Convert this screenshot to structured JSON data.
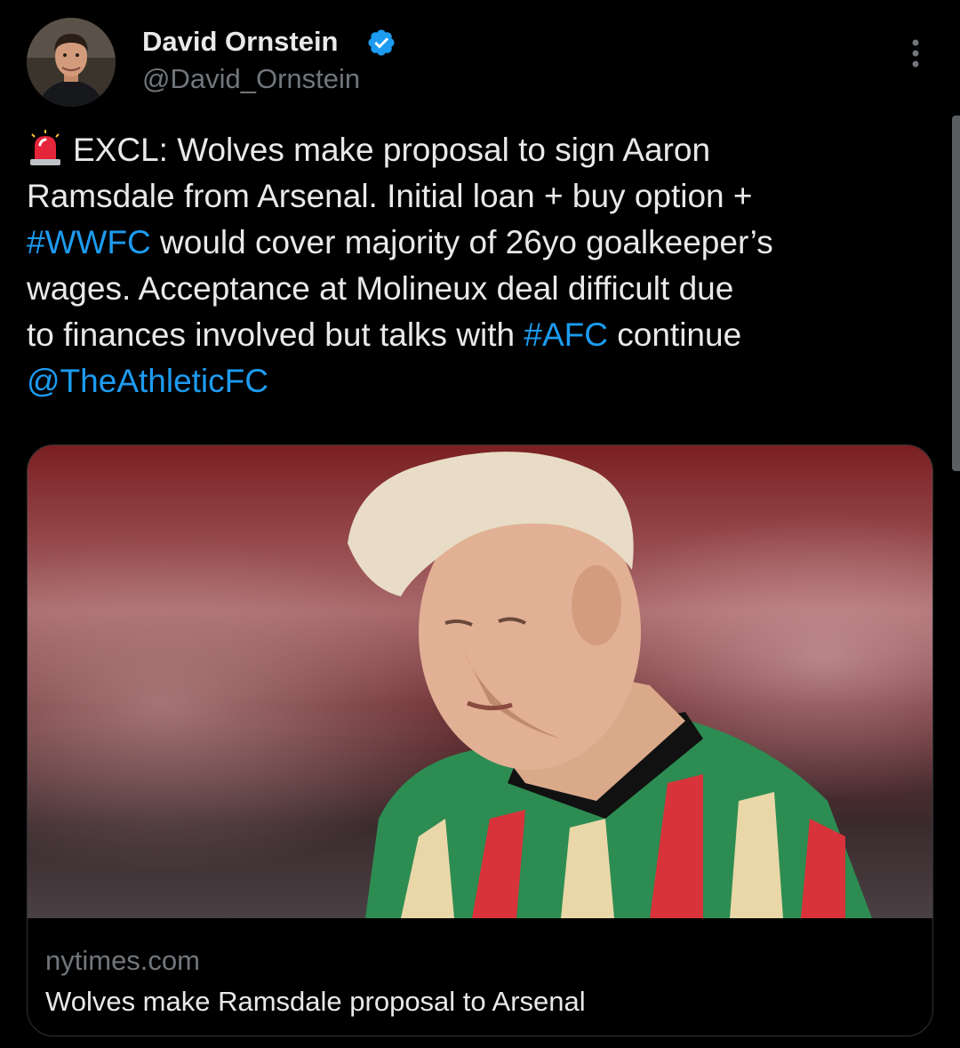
{
  "author": {
    "name": "David Ornstein",
    "handle": "@David_Ornstein",
    "verified_icon": "verified-badge-icon",
    "avatar_icon": "profile-avatar"
  },
  "menu": {
    "icon": "more-vertical-icon"
  },
  "tweet": {
    "emoji_icon": "police-siren-icon",
    "lines": [
      [
        "",
        "EXCL: Wolves make proposal to sign Aaron"
      ],
      [
        "Ramsdale from Arsenal. Initial loan + buy option +"
      ],
      [
        "#WWFC",
        " would cover majority of 26yo goalkeeper’s"
      ],
      [
        "wages. Acceptance at Molineux deal difficult due"
      ],
      [
        "to finances involved but talks with ",
        "#AFC",
        " continue"
      ],
      [
        "@TheAthleticFC"
      ]
    ]
  },
  "card": {
    "image_icon": "article-photo",
    "domain": "nytimes.com",
    "title": "Wolves make Ramsdale proposal to Arsenal"
  },
  "colors": {
    "background": "#000000",
    "text": "#e7e9ea",
    "secondary_text": "#71767b",
    "link": "#1d9bf0",
    "verified": "#1d9bf0",
    "card_border": "#2f3336"
  }
}
